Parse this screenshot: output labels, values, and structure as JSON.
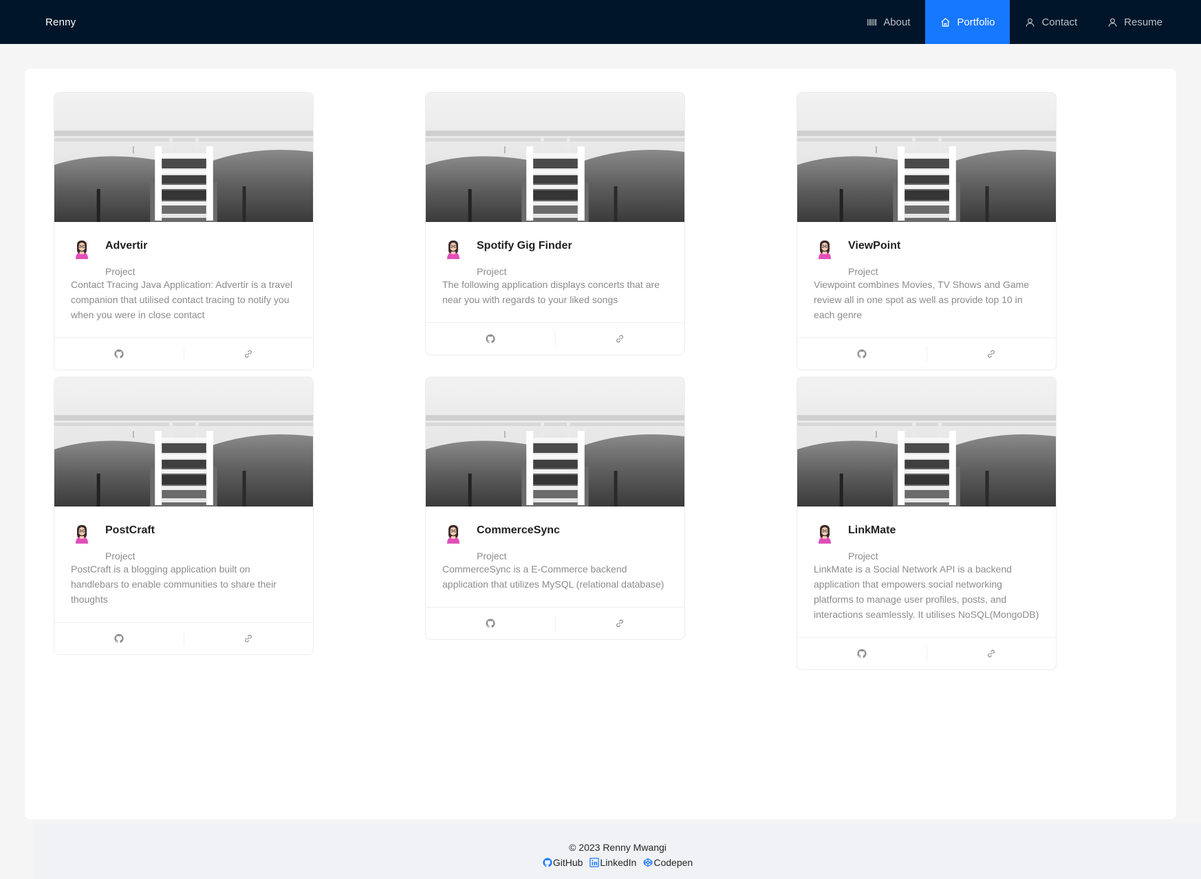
{
  "header": {
    "brand": "Renny",
    "nav": [
      {
        "label": "About",
        "icon": "barcode-icon",
        "active": false
      },
      {
        "label": "Portfolio",
        "icon": "home-icon",
        "active": true
      },
      {
        "label": "Contact",
        "icon": "user-icon",
        "active": false
      },
      {
        "label": "Resume",
        "icon": "user-icon",
        "active": false
      }
    ]
  },
  "cards": [
    {
      "title": "Advertir",
      "tag": "Project",
      "description": "Contact Tracing Java Application: Advertir is a travel companion that utilised contact tracing to notify you when you were in close contact"
    },
    {
      "title": "Spotify Gig Finder",
      "tag": "Project",
      "description": "The following application displays concerts that are near you with regards to your liked songs"
    },
    {
      "title": "ViewPoint",
      "tag": "Project",
      "description": "Viewpoint combines Movies, TV Shows and Game review all in one spot as well as provide top 10 in each genre"
    },
    {
      "title": "PostCraft",
      "tag": "Project",
      "description": "PostCraft is a blogging application built on handlebars to enable communities to share their thoughts"
    },
    {
      "title": "CommerceSync",
      "tag": "Project",
      "description": "CommerceSync is a E-Commerce backend application that utilizes MySQL (relational database)"
    },
    {
      "title": "LinkMate",
      "tag": "Project",
      "description": "LinkMate is a Social Network API is a backend application that empowers social networking platforms to manage user profiles, posts, and interactions seamlessly. It utilises NoSQL(MongoDB)"
    }
  ],
  "card_actions": {
    "github_icon": "github-icon",
    "link_icon": "link-icon"
  },
  "footer": {
    "copyright": "© 2023 Renny Mwangi",
    "links": [
      {
        "label": "GitHub",
        "icon": "github-icon"
      },
      {
        "label": "LinkedIn",
        "icon": "linkedin-icon"
      },
      {
        "label": "Codepen",
        "icon": "codepen-icon"
      }
    ]
  },
  "colors": {
    "header_bg": "#001529",
    "accent": "#1677ff",
    "footer_link": "#1677ff"
  }
}
